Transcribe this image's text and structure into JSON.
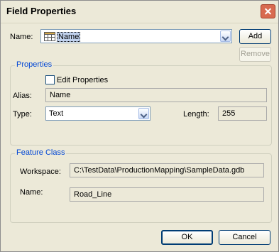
{
  "window": {
    "title": "Field Properties"
  },
  "name_row": {
    "label": "Name:",
    "selected": "Name",
    "add_label": "Add",
    "remove_label": "Remove"
  },
  "properties": {
    "group_title": "Properties",
    "edit_label": "Edit Properties",
    "alias_label": "Alias:",
    "alias_value": "Name",
    "type_label": "Type:",
    "type_value": "Text",
    "length_label": "Length:",
    "length_value": "255"
  },
  "feature_class": {
    "group_title": "Feature Class",
    "workspace_label": "Workspace:",
    "workspace_value": "C:\\TestData\\ProductionMapping\\SampleData.gdb",
    "name_label": "Name:",
    "name_value": "Road_Line"
  },
  "buttons": {
    "ok": "OK",
    "cancel": "Cancel"
  }
}
